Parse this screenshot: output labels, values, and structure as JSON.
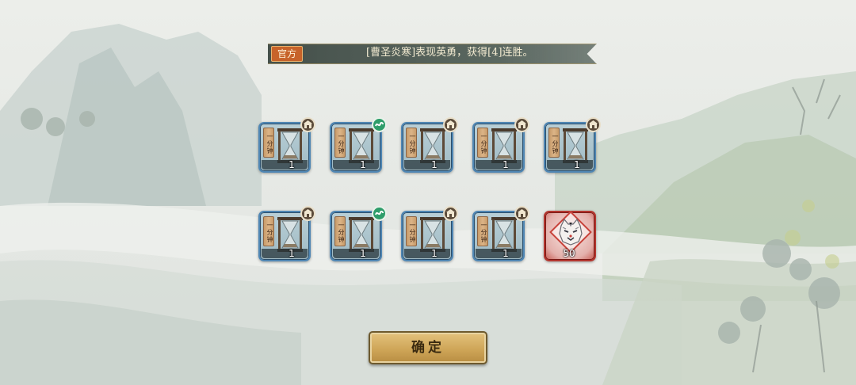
{
  "announcement": {
    "tag": "官方",
    "message": "[曹圣炎寒]表现英勇，获得[4]连胜。"
  },
  "rewards": [
    {
      "name": "一分钟",
      "label": "一\n分\n钟",
      "quantity": "1",
      "badge": "shop-icon"
    },
    {
      "name": "一分钟",
      "label": "一\n分\n钟",
      "quantity": "1",
      "badge": "event-icon"
    },
    {
      "name": "一分钟",
      "label": "一\n分\n钟",
      "quantity": "1",
      "badge": "shop-icon"
    },
    {
      "name": "一分钟",
      "label": "一\n分\n钟",
      "quantity": "1",
      "badge": "shop-icon"
    },
    {
      "name": "一分钟",
      "label": "一\n分\n钟",
      "quantity": "1",
      "badge": "shop-icon"
    },
    {
      "name": "一分钟",
      "label": "一\n分\n钟",
      "quantity": "1",
      "badge": "shop-icon"
    },
    {
      "name": "一分钟",
      "label": "一\n分\n钟",
      "quantity": "1",
      "badge": "event-icon"
    },
    {
      "name": "一分钟",
      "label": "一\n分\n钟",
      "quantity": "1",
      "badge": "shop-icon"
    },
    {
      "name": "一分钟",
      "label": "一\n分\n钟",
      "quantity": "1",
      "badge": "shop-icon"
    },
    {
      "name": "白虎头像",
      "quantity": "50",
      "badge": "none",
      "special": true
    }
  ],
  "confirm_label": "确定",
  "colors": {
    "card_border": "#4f86b3",
    "special_border": "#b3352e",
    "banner_tag": "#c7632a",
    "button_gold": "#cfa658"
  }
}
